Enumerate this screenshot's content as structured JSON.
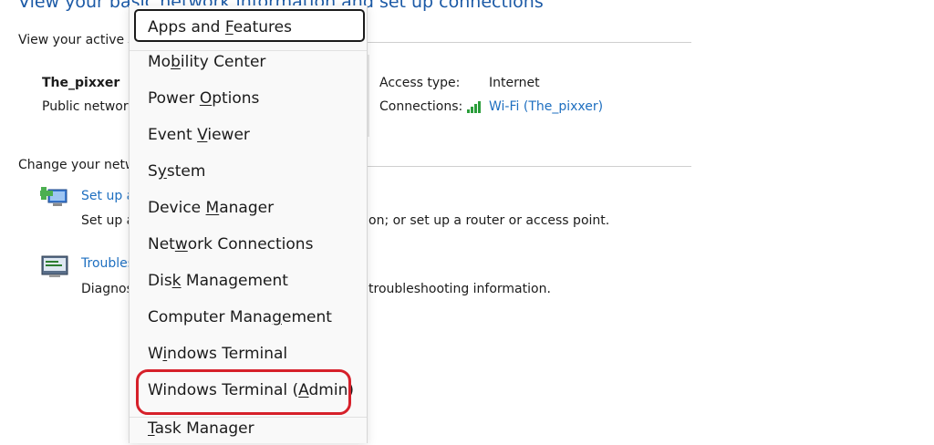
{
  "page": {
    "title": "View your basic network information and set up connections"
  },
  "active_networks": {
    "label": "View your active n",
    "network_name": "The_pixxer",
    "network_type": "Public network",
    "access_type_label": "Access type:",
    "access_type_value": "Internet",
    "connections_label": "Connections:",
    "connection_link": "Wi-Fi (The_pixxer)"
  },
  "change_settings": {
    "label": "Change your netw",
    "tasks": [
      {
        "link": "Set up a",
        "desc_start": "Set up a",
        "desc_end": "on; or set up a router or access point.",
        "icon": "network-setup-icon"
      },
      {
        "link": "Troubles",
        "desc_start": "Diagnos",
        "desc_end": "troubleshooting information.",
        "icon": "troubleshoot-icon"
      }
    ]
  },
  "context_menu": {
    "items": [
      {
        "pre": "Apps and ",
        "key": "F",
        "post": "eatures"
      },
      {
        "pre": "Mo",
        "key": "b",
        "post": "ility Center"
      },
      {
        "pre": "Power ",
        "key": "O",
        "post": "ptions"
      },
      {
        "pre": "Event ",
        "key": "V",
        "post": "iewer"
      },
      {
        "pre": "S",
        "key": "y",
        "post": "stem"
      },
      {
        "pre": "Device ",
        "key": "M",
        "post": "anager"
      },
      {
        "pre": "Net",
        "key": "w",
        "post": "ork Connections"
      },
      {
        "pre": "Dis",
        "key": "k",
        "post": " Management"
      },
      {
        "pre": "Computer Mana",
        "key": "g",
        "post": "ement"
      },
      {
        "pre": "W",
        "key": "i",
        "post": "ndows Terminal"
      },
      {
        "pre": "Windows Terminal (",
        "key": "A",
        "post": "dmin)"
      },
      {
        "pre": "",
        "key": "T",
        "post": "ask Manager"
      }
    ]
  },
  "colors": {
    "title_blue": "#1c5aa6",
    "link_blue": "#1e6fc0",
    "highlight_red": "#d6202a"
  }
}
